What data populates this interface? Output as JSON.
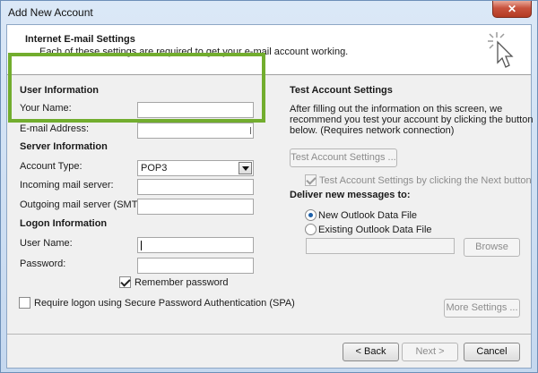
{
  "window": {
    "title": "Add New Account",
    "close_glyph": "✕"
  },
  "header": {
    "title": "Internet E-mail Settings",
    "subtitle": "Each of these settings are required to get your e-mail account working."
  },
  "user_info": {
    "heading": "User Information",
    "your_name_label": "Your Name:",
    "your_name_value": "",
    "email_label": "E-mail Address:",
    "email_value": ""
  },
  "server_info": {
    "heading": "Server Information",
    "account_type_label": "Account Type:",
    "account_type_value": "POP3",
    "incoming_label": "Incoming mail server:",
    "incoming_value": "",
    "outgoing_label": "Outgoing mail server (SMTP):",
    "outgoing_value": ""
  },
  "logon_info": {
    "heading": "Logon Information",
    "username_label": "User Name:",
    "username_value": "",
    "password_label": "Password:",
    "password_value": "",
    "remember_label": "Remember password",
    "remember_checked": true,
    "spa_label": "Require logon using Secure Password Authentication (SPA)",
    "spa_checked": false
  },
  "test_settings": {
    "heading": "Test Account Settings",
    "description_line1": "After filling out the information on this screen, we",
    "description_line2": "recommend you test your account by clicking the button",
    "description_line3": "below. (Requires network connection)",
    "test_button": "Test Account Settings ...",
    "test_on_next_label": "Test Account Settings by clicking the Next button",
    "test_on_next_checked": true
  },
  "deliver": {
    "heading": "Deliver new messages to:",
    "new_file_label": "New Outlook Data File",
    "existing_file_label": "Existing Outlook Data File",
    "selected": "new",
    "existing_path_value": "",
    "browse_button": "Browse"
  },
  "more_settings_button": "More Settings ...",
  "footer": {
    "back_button": "< Back",
    "next_button": "Next >",
    "cancel_button": "Cancel"
  },
  "colors": {
    "highlight": "#72ad2e"
  },
  "icons": {
    "header_icon": "click-cursor-icon"
  }
}
